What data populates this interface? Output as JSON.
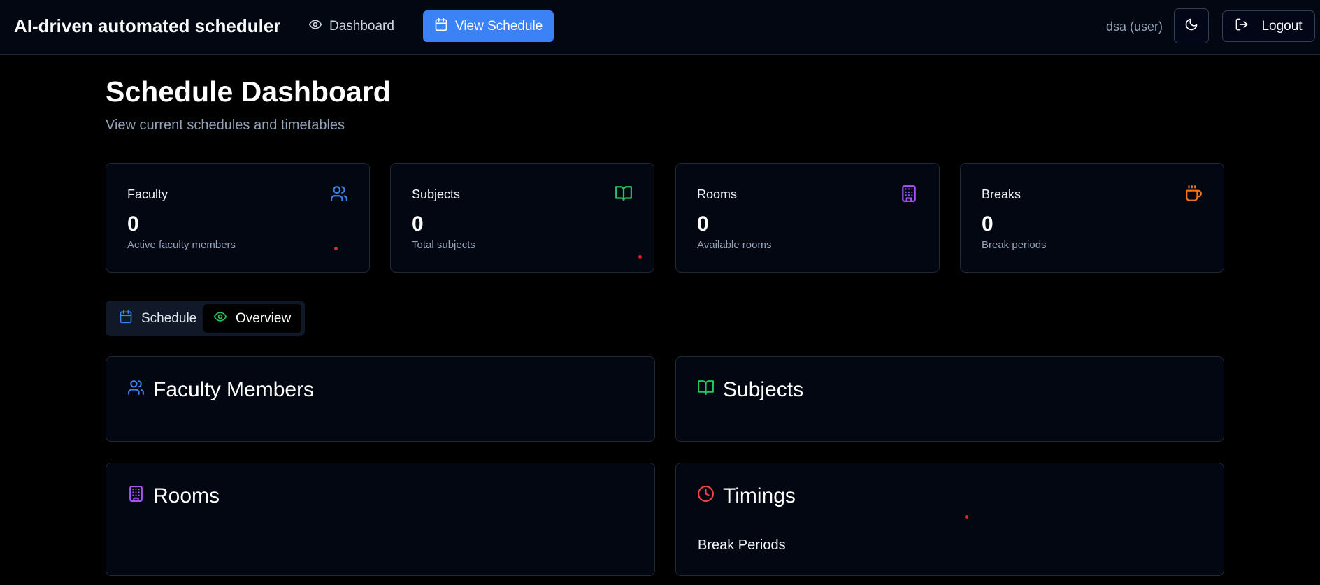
{
  "header": {
    "app_title": "AI-driven automated scheduler",
    "nav": {
      "dashboard_label": "Dashboard",
      "view_schedule_label": "View Schedule"
    },
    "user_label": "dsa (user)",
    "logout_label": "Logout"
  },
  "page": {
    "title": "Schedule Dashboard",
    "subtitle": "View current schedules and timetables"
  },
  "stats": [
    {
      "label": "Faculty",
      "value": "0",
      "description": "Active faculty members",
      "icon": "users-icon",
      "color": "#3b82f6"
    },
    {
      "label": "Subjects",
      "value": "0",
      "description": "Total subjects",
      "icon": "book-open-icon",
      "color": "#22c55e"
    },
    {
      "label": "Rooms",
      "value": "0",
      "description": "Available rooms",
      "icon": "building-icon",
      "color": "#a855f7"
    },
    {
      "label": "Breaks",
      "value": "0",
      "description": "Break periods",
      "icon": "coffee-icon",
      "color": "#f97316"
    }
  ],
  "tabs": {
    "schedule_label": "Schedule",
    "overview_label": "Overview",
    "selected": "Overview"
  },
  "sections": {
    "faculty_title": "Faculty Members",
    "subjects_title": "Subjects",
    "rooms_title": "Rooms",
    "timings_title": "Timings",
    "timings_subtitle": "Break Periods"
  },
  "colors": {
    "accent": "#3b82f6",
    "background": "#000000",
    "card": "#030712",
    "timings_icon": "#ef4444"
  }
}
